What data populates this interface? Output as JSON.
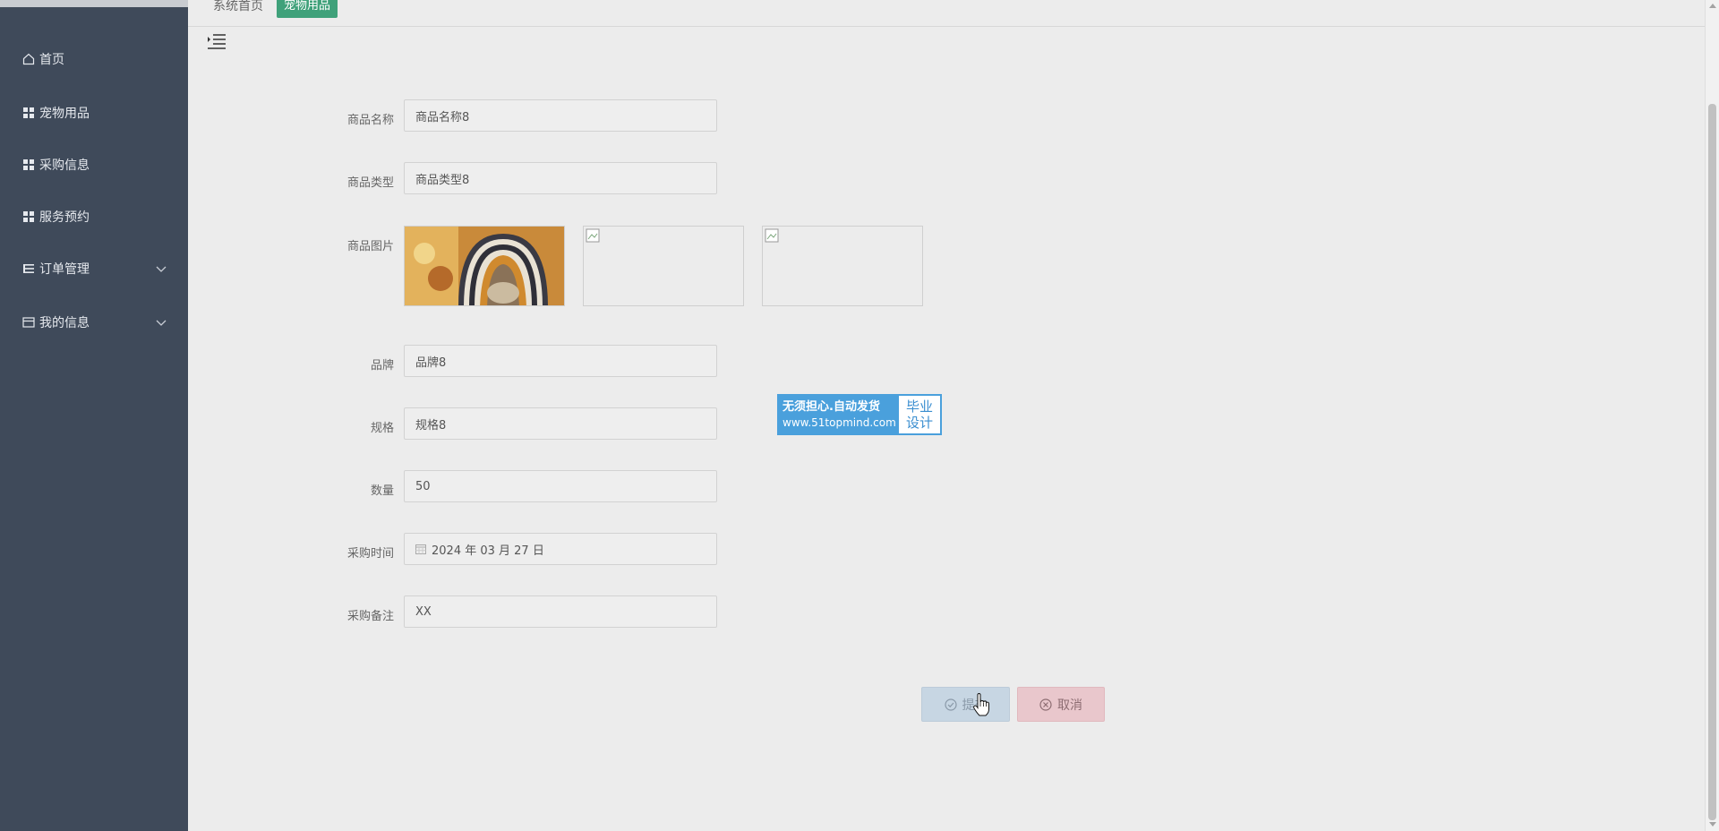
{
  "sidebar": {
    "items": [
      {
        "label": "首页",
        "icon": "home-icon"
      },
      {
        "label": "宠物用品",
        "icon": "grid-icon"
      },
      {
        "label": "采购信息",
        "icon": "grid-icon"
      },
      {
        "label": "服务预约",
        "icon": "grid-icon"
      },
      {
        "label": "订单管理",
        "icon": "list-icon"
      },
      {
        "label": "我的信息",
        "icon": "card-icon"
      }
    ]
  },
  "header": {
    "breadcrumb_home": "系统首页",
    "breadcrumb_tag": "宠物用品"
  },
  "form": {
    "product_name": {
      "label": "商品名称",
      "value": "商品名称8"
    },
    "product_type": {
      "label": "商品类型",
      "value": "商品类型8"
    },
    "product_image": {
      "label": "商品图片"
    },
    "brand": {
      "label": "品牌",
      "value": "品牌8"
    },
    "spec": {
      "label": "规格",
      "value": "规格8"
    },
    "quantity": {
      "label": "数量",
      "value": "50"
    },
    "purchase_time": {
      "label": "采购时间",
      "value": "2024 年 03 月 27 日"
    },
    "purchase_note": {
      "label": "采购备注",
      "value": "XX"
    }
  },
  "buttons": {
    "submit": "提交",
    "cancel": "取消"
  },
  "watermark": {
    "line1": "无须担心.自动发货",
    "line2": "www.51topmind.com",
    "right1": "毕业",
    "right2": "设计"
  },
  "colors": {
    "sidebar_bg": "#3f4a5a",
    "tag_green": "#3fa17a",
    "submit_bg": "#c7d6e3",
    "cancel_bg": "#e9c7cc",
    "watermark_blue": "#4aa0dc"
  }
}
